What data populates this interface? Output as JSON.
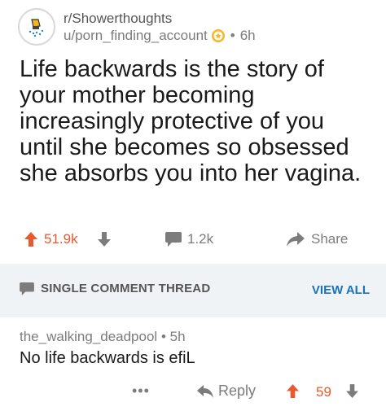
{
  "post": {
    "subreddit": "r/Showerthoughts",
    "author": "u/porn_finding_account",
    "age": "6h",
    "title": "Life backwards is the story of your mother becoming increasingly protective of you until she becomes so obsessed she absorbs you into her vagina.",
    "score": "51.9k",
    "comments": "1.2k",
    "share_label": "Share"
  },
  "thread": {
    "label": "SINGLE COMMENT THREAD",
    "view_all": "VIEW ALL"
  },
  "comment": {
    "author": "the_walking_deadpool",
    "age": "5h",
    "body": "No life backwards is efiL",
    "more": "•••",
    "reply_label": "Reply",
    "score": "59"
  },
  "colors": {
    "upvote": "#e8592e",
    "link": "#1a73b8",
    "muted": "#7c7c7c",
    "thread_bg": "#eff3f6",
    "award": "#f5b623"
  },
  "icons": {
    "subreddit_avatar": "lightbulb-shower-icon",
    "award": "award-icon",
    "upvote": "arrow-up-icon",
    "downvote": "arrow-down-icon",
    "comments": "comment-bubble-icon",
    "share": "share-arrow-icon",
    "thread": "comment-bubble-icon",
    "reply": "reply-arrow-icon"
  }
}
